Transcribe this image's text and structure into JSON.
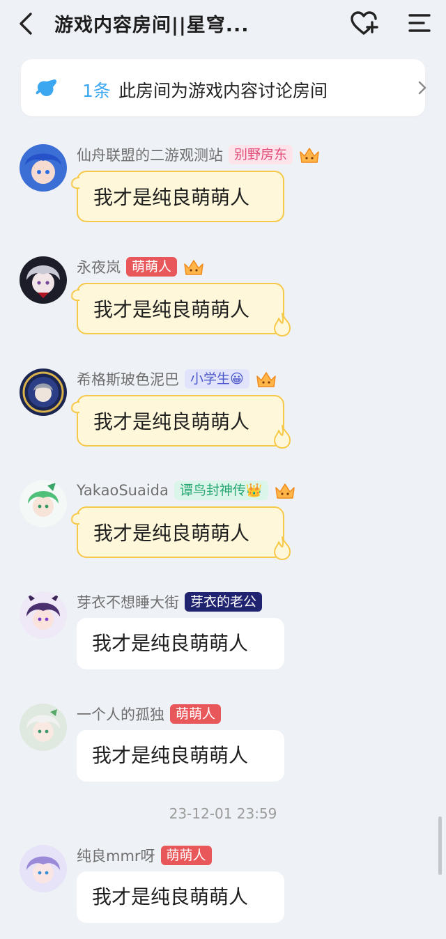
{
  "header": {
    "title": "游戏内容房间||星穹...",
    "back_icon": "chevron-left-icon",
    "heart_icon": "heart-plus-icon",
    "menu_icon": "menu-icon"
  },
  "notice": {
    "count": "1条",
    "text": "此房间为游戏内容讨论房间",
    "icon": "pin-icon",
    "accent": "#3aa7f0"
  },
  "messages": [
    {
      "username": "仙舟联盟的二游观测站",
      "tag": "别野房东",
      "tag_style": "pink",
      "content": "我才是纯良萌萌人"
    },
    {
      "username": "永夜岚",
      "tag": "萌萌人",
      "tag_style": "red",
      "content": "我才是纯良萌萌人"
    },
    {
      "username": "希格斯玻色泥巴",
      "tag": "小学生😀",
      "tag_style": "lavender",
      "content": "我才是纯良萌萌人"
    },
    {
      "username": "YakaoSuaida",
      "tag": "谭鸟封神传👑",
      "tag_style": "green",
      "content": "我才是纯良萌萌人"
    },
    {
      "username": "芽衣不想睡大街",
      "tag": "芽衣的老公",
      "tag_style": "navy",
      "content": "我才是纯良萌萌人"
    },
    {
      "username": "一个人的孤独",
      "tag": "萌萌人",
      "tag_style": "red",
      "content": "我才是纯良萌萌人"
    },
    {
      "username": "纯良mmr呀",
      "tag": "萌萌人",
      "tag_style": "red",
      "content": "我才是纯良萌萌人"
    }
  ],
  "timestamp": "23-12-01 23:59",
  "colors": {
    "background": "#eef1f5",
    "gold_bubble": "#fff7d9",
    "gold_border": "#f7c94a",
    "tag_red": "#e8585a",
    "tag_pink_bg": "#fde3ea",
    "tag_pink_fg": "#e24d7a",
    "tag_lavender_bg": "#e2e4fb",
    "tag_lavender_fg": "#4a57c9",
    "tag_green_bg": "#dcf5ea",
    "tag_green_fg": "#26a772",
    "tag_navy": "#1f2370"
  }
}
